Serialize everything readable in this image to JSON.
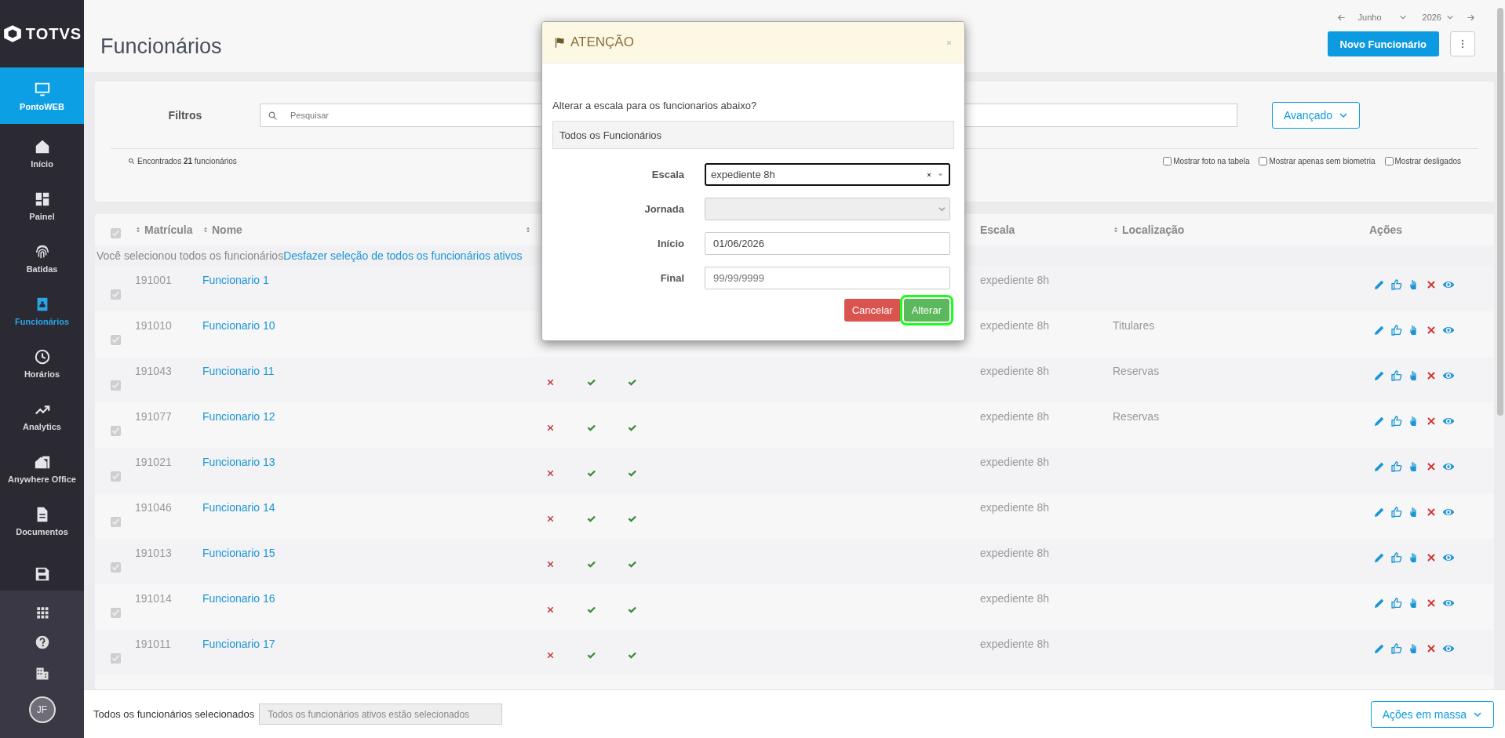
{
  "sidebar": {
    "logo": "TOTVS",
    "module": {
      "label": "PontoWEB",
      "selected": true
    },
    "items": [
      {
        "label": "Início",
        "kind": "home",
        "selected": false
      },
      {
        "label": "Painel",
        "kind": "dashboard",
        "selected": false
      },
      {
        "label": "Batidas",
        "kind": "fingerprint",
        "selected": false
      },
      {
        "label": "Funcionários",
        "kind": "badge",
        "selected": true
      },
      {
        "label": "Horários",
        "kind": "clock",
        "selected": false
      },
      {
        "label": "Analytics",
        "kind": "trend",
        "selected": false
      },
      {
        "label": "Anywhere Office",
        "kind": "office",
        "selected": false
      },
      {
        "label": "Documentos",
        "kind": "document",
        "selected": false
      },
      {
        "kind": "save",
        "selected": false
      }
    ],
    "avatar": "JF"
  },
  "header": {
    "title": "Funcionários",
    "month": "Junho",
    "year": "2026",
    "new_button": "Novo Funcionário"
  },
  "filters": {
    "label": "Filtros",
    "search": {
      "placeholder": "Pesquisar"
    },
    "advanced_button": "Avançado",
    "found": "Encontrados **21** funcionários",
    "options": [
      {
        "label": "Mostrar foto na tabela",
        "checked": false
      },
      {
        "label": "Mostrar apenas sem biometria",
        "checked": false
      },
      {
        "label": "Mostrar desligados",
        "checked": false
      }
    ]
  },
  "table": {
    "all_checked": true,
    "columns": [
      {
        "label": "Matrícula",
        "sortable": true
      },
      {
        "label": "Nome",
        "sortable": true
      },
      {
        "sortable": true
      },
      {
        "label": "Escala",
        "sortable": false
      },
      {
        "label": "Localização",
        "sortable": true
      },
      {
        "label": "Ações",
        "sortable": false
      }
    ],
    "selection_notice": {
      "text": "Você selecionou todos os funcionários",
      "link": "Desfazer seleção de todos os funcionários ativos"
    },
    "rows": [
      {
        "checked": true,
        "matricula": "191001",
        "nome": "Funcionario 1",
        "escala": "expediente 8h"
      },
      {
        "checked": true,
        "matricula": "191010",
        "nome": "Funcionario 10",
        "escala": "expediente 8h",
        "localizacao": "Titulares"
      },
      {
        "checked": true,
        "matricula": "191043",
        "nome": "Funcionario 11",
        "escala": "expediente 8h",
        "localizacao": "Reservas",
        "status": [
          false,
          true,
          true
        ]
      },
      {
        "checked": true,
        "matricula": "191077",
        "nome": "Funcionario 12",
        "escala": "expediente 8h",
        "localizacao": "Reservas",
        "status": [
          false,
          true,
          true
        ]
      },
      {
        "checked": true,
        "matricula": "191021",
        "nome": "Funcionario 13",
        "escala": "expediente 8h",
        "status": [
          false,
          true,
          true
        ]
      },
      {
        "checked": true,
        "matricula": "191046",
        "nome": "Funcionario 14",
        "escala": "expediente 8h",
        "status": [
          false,
          true,
          true
        ]
      },
      {
        "checked": true,
        "matricula": "191013",
        "nome": "Funcionario 15",
        "escala": "expediente 8h",
        "status": [
          false,
          true,
          true
        ]
      },
      {
        "checked": true,
        "matricula": "191014",
        "nome": "Funcionario 16",
        "escala": "expediente 8h",
        "status": [
          false,
          true,
          true
        ]
      },
      {
        "checked": true,
        "matricula": "191011",
        "nome": "Funcionario 17",
        "escala": "expediente 8h",
        "status": [
          false,
          true,
          true
        ]
      }
    ]
  },
  "bottom_bar": {
    "label": "Todos os funcionários selecionados",
    "field_value": "Todos os funcionários ativos estão selecionados",
    "mass_actions_button": "Ações em massa"
  },
  "dialog": {
    "title": "ATENÇÃO",
    "question": "Alterar a escala para os funcionarios abaixo?",
    "selection": "Todos os Funcionários",
    "fields": [
      {
        "label": "Escala",
        "kind": "select2",
        "value": "expediente 8h",
        "focused": true
      },
      {
        "label": "Jornada",
        "kind": "select",
        "disabled": true
      },
      {
        "label": "Início",
        "kind": "text",
        "value": "01/06/2026"
      },
      {
        "label": "Final",
        "kind": "text",
        "placeholder": "99/99/9999"
      }
    ],
    "buttons": [
      {
        "label": "Cancelar",
        "kind": "danger",
        "highlighted": false
      },
      {
        "label": "Alterar",
        "kind": "success",
        "highlighted": true
      }
    ]
  }
}
